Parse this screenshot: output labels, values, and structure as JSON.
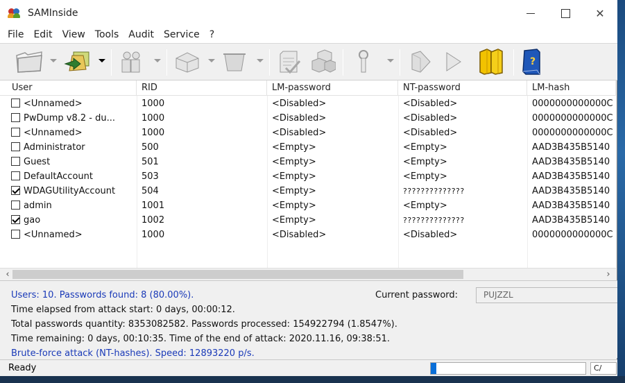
{
  "window": {
    "title": "SAMInside",
    "minimize_label": "",
    "maximize_label": "",
    "close_label": "✕"
  },
  "menu": [
    "File",
    "Edit",
    "View",
    "Tools",
    "Audit",
    "Service",
    "?"
  ],
  "toolbar": {
    "icons": [
      "open-folder-icon",
      "import-icon",
      "users-icon",
      "save-icon",
      "delete-icon",
      "report-icon",
      "boxes-icon",
      "key-icon",
      "start-icon",
      "play-icon",
      "pause-icon",
      "help-book-icon"
    ]
  },
  "table": {
    "columns": [
      "User",
      "RID",
      "LM-password",
      "NT-password",
      "LM-hash"
    ],
    "rows": [
      {
        "checked": false,
        "user": "<Unnamed>",
        "rid": "1000",
        "lm": "<Disabled>",
        "nt": "<Disabled>",
        "lmhash": "0000000000000C"
      },
      {
        "checked": false,
        "user": "PwDump v8.2 - du...",
        "rid": "1000",
        "lm": "<Disabled>",
        "nt": "<Disabled>",
        "lmhash": "0000000000000C"
      },
      {
        "checked": false,
        "user": "<Unnamed>",
        "rid": "1000",
        "lm": "<Disabled>",
        "nt": "<Disabled>",
        "lmhash": "0000000000000C"
      },
      {
        "checked": false,
        "user": "Administrator",
        "rid": "500",
        "lm": "<Empty>",
        "nt": "<Empty>",
        "lmhash": "AAD3B435B5140"
      },
      {
        "checked": false,
        "user": "Guest",
        "rid": "501",
        "lm": "<Empty>",
        "nt": "<Empty>",
        "lmhash": "AAD3B435B5140"
      },
      {
        "checked": false,
        "user": "DefaultAccount",
        "rid": "503",
        "lm": "<Empty>",
        "nt": "<Empty>",
        "lmhash": "AAD3B435B5140"
      },
      {
        "checked": true,
        "user": "WDAGUtilityAccount",
        "rid": "504",
        "lm": "<Empty>",
        "nt": "??????????????",
        "lmhash": "AAD3B435B5140"
      },
      {
        "checked": false,
        "user": "admin",
        "rid": "1001",
        "lm": "<Empty>",
        "nt": "<Empty>",
        "lmhash": "AAD3B435B5140"
      },
      {
        "checked": true,
        "user": "gao",
        "rid": "1002",
        "lm": "<Empty>",
        "nt": "??????????????",
        "lmhash": "AAD3B435B5140"
      },
      {
        "checked": false,
        "user": "<Unnamed>",
        "rid": "1000",
        "lm": "<Disabled>",
        "nt": "<Disabled>",
        "lmhash": "0000000000000C"
      }
    ]
  },
  "scroll": {
    "left": "‹",
    "right": "›"
  },
  "status": {
    "line1": "Users: 10. Passwords found: 8 (80.00%).",
    "line2": "Time elapsed from attack start: 0 days, 00:00:12.",
    "line3": "Total passwords quantity: 8353082582. Passwords processed: 154922794 (1.8547%).",
    "line4": "Time remaining: 0 days, 00:10:35. Time of the end of attack: 2020.11.16, 09:38:51.",
    "line5": "Brute-force attack (NT-hashes). Speed: 12893220 p/s.",
    "current_password_label": "Current password:",
    "current_password": "PUJZZL"
  },
  "statusbar": {
    "text": "Ready",
    "progress": 0.0185,
    "extra": "C/"
  },
  "colors": {
    "blue_text": "#1a3ab8",
    "progress_fill": "#0a6fd8"
  }
}
